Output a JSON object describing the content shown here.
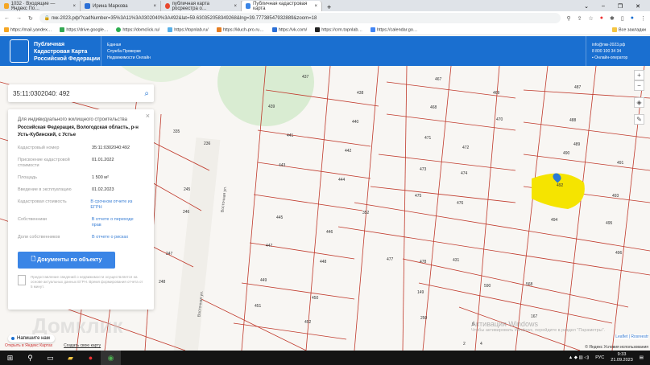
{
  "browser": {
    "tabs": [
      {
        "label": "1032 · Входящие — Яндекс По…",
        "color": "#f5a623"
      },
      {
        "label": "Ирина Маркова",
        "color": "#2b6fd6"
      },
      {
        "label": "публичная карта росреестра о…",
        "color": "#e8472d"
      },
      {
        "label": "Публичная кадастровая карта",
        "color": "#3a85e6",
        "active": true
      }
    ],
    "new_tab": "+",
    "url": "пкк-2023.рф/?cadNumber=35%3A11%3A0302040%3A492&lat=59.630352058349268&lng=39.77738547932889&zoom=18",
    "bookmarks": [
      "https://mail.yandex…",
      "https://drive.google…",
      "https://domclick.ru/",
      "https://topnlab.ru/",
      "https://kluch-pro.ru…",
      "https://vk.com/",
      "https://crm.topnlab…",
      "https://calendar.go…"
    ],
    "all_bookmarks": "Все закладки"
  },
  "header": {
    "brand": [
      "Публичная",
      "Кадастровая Карта",
      "Российской Федерации"
    ],
    "sub": [
      "Единая",
      "Служба Проверки",
      "Недвижимости Онлайн"
    ],
    "email": "info@пкк-2023.рф",
    "phone": "8 800 100 34 34",
    "operator": "Онлайн-оператор"
  },
  "search": {
    "value": "35:11:0302040: 492"
  },
  "card": {
    "purpose": "Для индивидуального жилищного строительства",
    "address": "Российская Федерация, Вологодская область, р-н Усть-Кубинский, с Устье",
    "rows": [
      {
        "k": "Кадастровый номер",
        "v": "35:11:0302040:492"
      },
      {
        "k": "Присвоение кадастровой стоимости",
        "v": "01.01.2022"
      },
      {
        "k": "Площадь",
        "v": "1 500 м²"
      },
      {
        "k": "Введение в эксплуатацию",
        "v": "01.02.2023"
      },
      {
        "k": "Кадастровая стоимость",
        "v": "В срочном отчете из ЕГРН",
        "link": true
      },
      {
        "k": "Собственники",
        "v": "В отчете о переходе прав",
        "link": true
      },
      {
        "k": "Доли собственников",
        "v": "В отчете о рисках",
        "link": true
      }
    ],
    "button": "Документы по объекту",
    "note": "Предоставление сведений о недвижимости осуществляется на основе актуальных данных ЕГРН. Время формирования отчета от 5 минут."
  },
  "map": {
    "parcels": [
      "437",
      "438",
      "439",
      "440",
      "441",
      "442",
      "443",
      "444",
      "445",
      "446",
      "447",
      "448",
      "449",
      "450",
      "451",
      "452",
      "467",
      "468",
      "469",
      "470",
      "471",
      "472",
      "473",
      "474",
      "475",
      "476",
      "477",
      "478",
      "431",
      "487",
      "488",
      "489",
      "490",
      "491",
      "492",
      "493",
      "494",
      "495",
      "496",
      "352",
      "335",
      "236",
      "245",
      "246",
      "247",
      "248",
      "568",
      "590",
      "167",
      "5",
      "4",
      "2",
      "149",
      "250"
    ],
    "street": "Восточная ул.",
    "highlight": "#f5e400",
    "line_color": "#c0392b",
    "watermark": "Домклик",
    "chat": "Напишите нам",
    "yandex_open": "Открыть в Яндекс Картах",
    "create_map": "Создать свою карту",
    "attribution": "Leaflet | Rosreestr",
    "yandex_terms": "© Яндекс Условия использования"
  },
  "os": {
    "activate_title": "Активация Windows",
    "activate_sub": "Чтобы активировать Windows, перейдите в раздел \"Параметры\".",
    "lang": "РУС",
    "time": "9:33",
    "date": "21.09.2023"
  }
}
